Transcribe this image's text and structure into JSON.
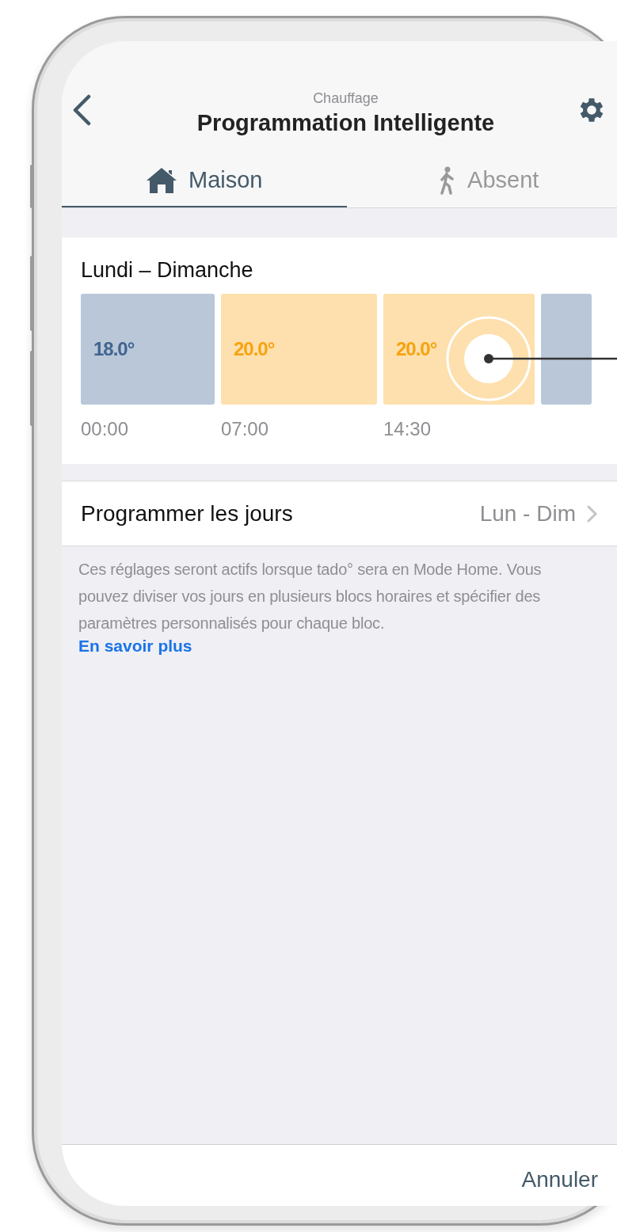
{
  "header": {
    "subtitle": "Chauffage",
    "title": "Programmation Intelligente"
  },
  "tabs": [
    {
      "label": "Maison",
      "selected": true
    },
    {
      "label": "Absent",
      "selected": false
    }
  ],
  "schedule": {
    "title": "Lundi – Dimanche",
    "blocks": [
      {
        "kind": "cool",
        "temperature": "18.0°",
        "time": "00:00",
        "selected": false
      },
      {
        "kind": "warm",
        "temperature": "20.0°",
        "time": "07:00",
        "selected": false
      },
      {
        "kind": "warm",
        "temperature": "20.0°",
        "time": "14:30",
        "selected": true
      },
      {
        "kind": "cool",
        "selected": false
      }
    ]
  },
  "days_row": {
    "label": "Programmer les jours",
    "value": "Lun - Dim"
  },
  "description": {
    "text": "Ces réglages seront actifs lorsque tado° sera en Mode Home. Vous pouvez diviser vos jours en plusieurs blocs horaires et spécifier des paramètres personnalisés pour chaque bloc.",
    "link": "En savoir plus"
  },
  "footer": {
    "cancel": "Annuler"
  }
}
